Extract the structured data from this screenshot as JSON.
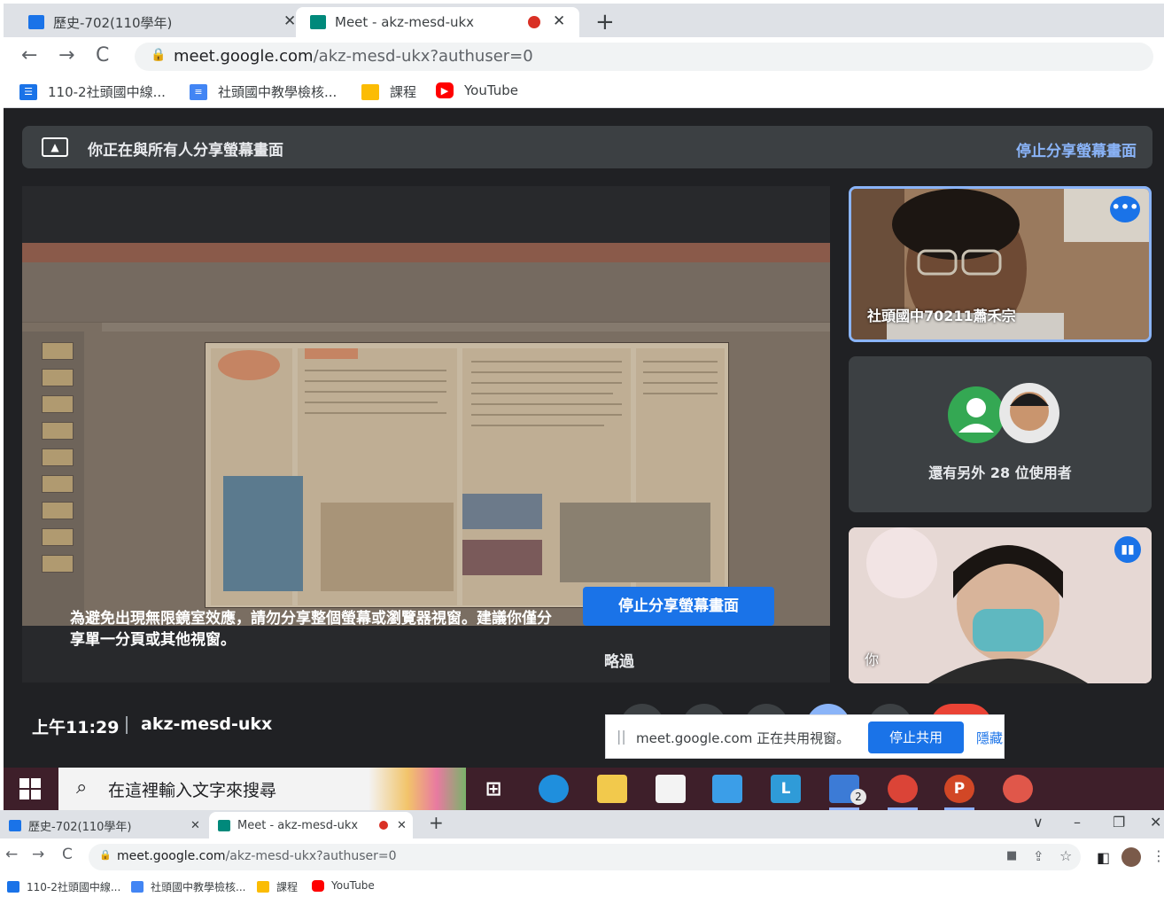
{
  "browser": {
    "tabs": [
      {
        "title": "歷史-702(110學年)",
        "close": "✕"
      },
      {
        "title": "Meet - akz-mesd-ukx",
        "close": "✕"
      }
    ],
    "new_tab": "+",
    "url_host": "meet.google.com",
    "url_path": "/akz-mesd-ukx?authuser=0",
    "bookmarks": [
      "110-2社頭國中線...",
      "社頭國中教學檢核...",
      "課程",
      "YouTube"
    ]
  },
  "meet": {
    "share_banner": "你正在與所有人分享螢幕畫面",
    "share_banner_stop": "停止分享螢幕畫面",
    "warning": "為避免出現無限鏡室效應，請勿分享整個螢幕或瀏覽器視窗。建議你僅分享單一分頁或其他視窗。",
    "stop_button": "停止分享螢幕畫面",
    "skip": "略過",
    "participants": [
      {
        "name": "社頭國中70211蕭禾宗",
        "more": "•••"
      },
      {
        "name": "還有另外 28 位使用者"
      },
      {
        "name": "你"
      }
    ],
    "time": "上午11:29",
    "meeting_code": "akz-mesd-ukx",
    "sharing_notice": "meet.google.com 正在共用視窗。",
    "sharing_stop": "停止共用",
    "sharing_hide": "隱藏"
  },
  "taskbar": {
    "search_placeholder": "在這裡輸入文字來搜尋",
    "badge": "2"
  },
  "browser2": {
    "tabs": [
      {
        "title": "歷史-702(110學年)",
        "close": "✕"
      },
      {
        "title": "Meet - akz-mesd-ukx",
        "close": "✕"
      }
    ],
    "new_tab": "+",
    "url_host": "meet.google.com",
    "url_path": "/akz-mesd-ukx?authuser=0",
    "bookmarks": [
      "110-2社頭國中線...",
      "社頭國中教學檢核...",
      "課程",
      "YouTube"
    ]
  },
  "colors": {
    "meet_bg": "#202124",
    "accent": "#1a73e8",
    "link": "#8ab4f8"
  }
}
